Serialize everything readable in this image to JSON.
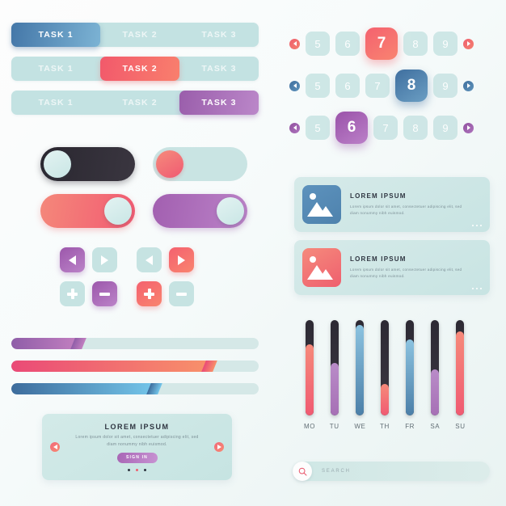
{
  "theme": {
    "background": "#f7fbfb",
    "mint": "#c6e3e2",
    "red": "#f2596b",
    "blue": "#4477a8",
    "purple": "#9a5eab",
    "dark": "#2d2a34"
  },
  "task_bars": [
    {
      "active_index": 0,
      "active_color": "blue",
      "segments": [
        {
          "label": "TASK 1",
          "width_pct": 36
        },
        {
          "label": "TASK 2",
          "width_pct": 32
        },
        {
          "label": "TASK 3",
          "width_pct": 32
        }
      ]
    },
    {
      "active_index": 1,
      "active_color": "red",
      "segments": [
        {
          "label": "TASK 1",
          "width_pct": 36
        },
        {
          "label": "TASK 2",
          "width_pct": 32
        },
        {
          "label": "TASK 3",
          "width_pct": 32
        }
      ]
    },
    {
      "active_index": 2,
      "active_color": "purple",
      "segments": [
        {
          "label": "TASK 1",
          "width_pct": 36
        },
        {
          "label": "TASK 2",
          "width_pct": 32
        },
        {
          "label": "TASK 3",
          "width_pct": 32
        }
      ]
    }
  ],
  "pagination": [
    {
      "color": "red",
      "prev_icon": "chevron-left-icon",
      "next_icon": "chevron-right-icon",
      "pages": [
        "5",
        "6",
        "7",
        "8",
        "9"
      ],
      "active": "7"
    },
    {
      "color": "blue",
      "prev_icon": "chevron-left-icon",
      "next_icon": "chevron-right-icon",
      "pages": [
        "5",
        "6",
        "7",
        "8",
        "9"
      ],
      "active": "8"
    },
    {
      "color": "purple",
      "prev_icon": "chevron-left-icon",
      "next_icon": "chevron-right-icon",
      "pages": [
        "5",
        "6",
        "7",
        "8",
        "9"
      ],
      "active": "6"
    }
  ],
  "toggles": [
    {
      "track": "dark",
      "knob": "mint",
      "position": "left",
      "state": "off"
    },
    {
      "track": "light",
      "knob": "redk",
      "position": "left",
      "state": "off"
    },
    {
      "track": "red",
      "knob": "mint",
      "position": "right",
      "state": "on"
    },
    {
      "track": "purple",
      "knob": "mint",
      "position": "right",
      "state": "on"
    }
  ],
  "control_buttons": [
    [
      {
        "icon": "arrow-left-icon",
        "color": "purple"
      },
      {
        "icon": "arrow-right-icon",
        "color": "light"
      },
      {
        "icon": "arrow-left-icon",
        "color": "light"
      },
      {
        "icon": "arrow-right-icon",
        "color": "red"
      }
    ],
    [
      {
        "icon": "plus-icon",
        "color": "light"
      },
      {
        "icon": "minus-icon",
        "color": "purple"
      },
      {
        "icon": "plus-icon",
        "color": "red"
      },
      {
        "icon": "minus-icon",
        "color": "light"
      }
    ]
  ],
  "progress_bars": [
    {
      "color": "purple",
      "value": 27
    },
    {
      "color": "red",
      "value": 80
    },
    {
      "color": "blue",
      "value": 58
    }
  ],
  "carousel": {
    "title": "LOREM IPSUM",
    "body": "Lorem ipsum dolor sit amet, consectetuer adipiscing elit, sed diam nonummy nibh euismod.",
    "button_label": "SIGN IN",
    "prev_icon": "chevron-left-icon",
    "next_icon": "chevron-right-icon",
    "dots": 3,
    "active_dot": 1
  },
  "media_cards": [
    {
      "thumb_color": "blue",
      "thumb_icon": "image-placeholder-icon",
      "title": "LOREM IPSUM",
      "body": "Lorem ipsum dolor sit amet, consectetuer adipiscing elit, sed diam nonummy nibh euismod.",
      "menu_icon": "more-dots-icon"
    },
    {
      "thumb_color": "red",
      "thumb_icon": "image-placeholder-icon",
      "title": "LOREM IPSUM",
      "body": "Lorem ipsum dolor sit amet, consectetuer adipiscing elit, sed diam nonummy nibh euismod.",
      "menu_icon": "more-dots-icon"
    }
  ],
  "sliders": {
    "days": [
      "MO",
      "TU",
      "WE",
      "TH",
      "FR",
      "SA",
      "SU"
    ],
    "values": [
      75,
      55,
      95,
      33,
      80,
      48,
      88
    ],
    "colors": [
      "red",
      "purple",
      "blue",
      "red",
      "blue",
      "purple",
      "red"
    ]
  },
  "search": {
    "icon": "search-icon",
    "placeholder": "SEARCH",
    "value": ""
  }
}
